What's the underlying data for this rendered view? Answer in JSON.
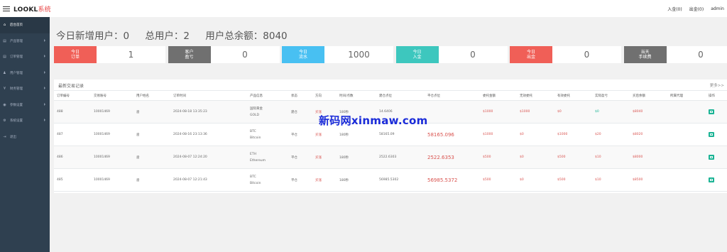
{
  "app": {
    "brand_main": "LOOKL",
    "brand_accent": "系统"
  },
  "topbar": {
    "deposit": "入金(0)",
    "withdraw": "出金(0)",
    "user": "admin"
  },
  "sidebar": {
    "items": [
      {
        "label": "后台首页",
        "icon": "home-icon",
        "glyph": "⌂",
        "active": true,
        "has_sub": false
      },
      {
        "label": "产品管理",
        "icon": "box-icon",
        "glyph": "▤",
        "active": false,
        "has_sub": true
      },
      {
        "label": "订单管理",
        "icon": "list-icon",
        "glyph": "▤",
        "active": false,
        "has_sub": true
      },
      {
        "label": "用户管理",
        "icon": "user-icon",
        "glyph": "♟",
        "active": false,
        "has_sub": true
      },
      {
        "label": "财务管理",
        "icon": "finance-icon",
        "glyph": "¥",
        "active": false,
        "has_sub": true
      },
      {
        "label": "参数设置",
        "icon": "settings-icon",
        "glyph": "◉",
        "active": false,
        "has_sub": true
      },
      {
        "label": "系统设置",
        "icon": "gear-icon",
        "glyph": "⚙",
        "active": false,
        "has_sub": true
      },
      {
        "label": "退出",
        "icon": "logout-icon",
        "glyph": "⇥",
        "active": false,
        "has_sub": false
      }
    ]
  },
  "stats": {
    "new_users_today": "今日新增用户：0",
    "total_users": "总用户：2",
    "total_balance": "用户总余额：8040"
  },
  "cards": [
    {
      "l1": "今日",
      "l2": "订单",
      "value": "1",
      "color": "#f05f57"
    },
    {
      "l1": "客户",
      "l2": "盈亏",
      "value": "0",
      "color": "#707070"
    },
    {
      "l1": "今日",
      "l2": "流水",
      "value": "1000",
      "color": "#48c0f2"
    },
    {
      "l1": "今日",
      "l2": "入金",
      "value": "0",
      "color": "#3dc7be"
    },
    {
      "l1": "今日",
      "l2": "出金",
      "value": "0",
      "color": "#f05f57"
    },
    {
      "l1": "当天",
      "l2": "手续费",
      "value": "0",
      "color": "#707070"
    }
  ],
  "panel": {
    "title": "最新交易记录",
    "more": "更多>>"
  },
  "table": {
    "headers": [
      "订单编号",
      "交易账号",
      "用户姓名",
      "订单时间",
      "产品信息",
      "状态",
      "方向",
      "时间/点数",
      "建仓点位",
      "平仓点位",
      "委托金额",
      "无效委托",
      "有效委托",
      "实际盈亏",
      "买后余额",
      "所属代理",
      "操作"
    ],
    "rows": [
      {
        "order_no": "488",
        "account": "10001469",
        "name": "啬",
        "time": "2024-08-18 13:35:23",
        "product_l1": "国际黄金",
        "product_l2": "GOLD",
        "status": "建仓",
        "direction": "买涨",
        "duration": "180秒",
        "open_price": "14.6406",
        "close_price": "",
        "amount": "$1000",
        "invalid": "$1000",
        "valid": "$0",
        "pnl": "$0",
        "balance": "$8040",
        "agent": ""
      },
      {
        "order_no": "487",
        "account": "10001469",
        "name": "啬",
        "time": "2024-08-16 23:13:36",
        "product_l1": "BTC",
        "product_l2": "Bitcoin",
        "status": "平仓",
        "direction": "买涨",
        "duration": "180秒",
        "open_price": "58165.09",
        "close_price": "58165.096",
        "amount": "$1000",
        "invalid": "$0",
        "valid": "$1000",
        "pnl": "$20",
        "balance": "$8020",
        "agent": ""
      },
      {
        "order_no": "486",
        "account": "10001469",
        "name": "啬",
        "time": "2024-08-07 12:24:20",
        "product_l1": "ETH",
        "product_l2": "Ethereum",
        "status": "平仓",
        "direction": "买涨",
        "duration": "180秒",
        "open_price": "2522.6303",
        "close_price": "2522.6353",
        "amount": "$500",
        "invalid": "$0",
        "valid": "$500",
        "pnl": "$10",
        "balance": "$8000",
        "agent": ""
      },
      {
        "order_no": "485",
        "account": "10001469",
        "name": "啬",
        "time": "2024-08-07 12:21:43",
        "product_l1": "BTC",
        "product_l2": "Bitcoin",
        "status": "平仓",
        "direction": "买涨",
        "duration": "180秒",
        "open_price": "56985.5302",
        "close_price": "56985.5372",
        "amount": "$500",
        "invalid": "$0",
        "valid": "$500",
        "pnl": "$10",
        "balance": "$8500",
        "agent": ""
      }
    ]
  },
  "watermark": "新码网xinmaw.com"
}
